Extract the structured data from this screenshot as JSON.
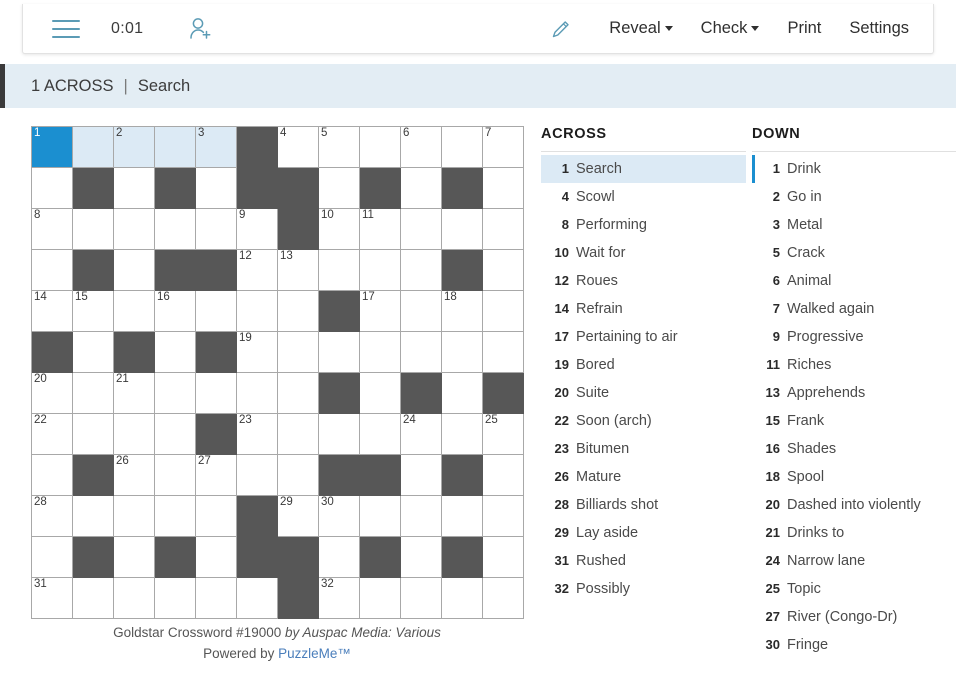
{
  "toolbar": {
    "menu_icon": "hamburger-icon",
    "timer": "0:01",
    "add_person_icon": "person-add-icon",
    "pencil_icon": "pencil-icon",
    "reveal_label": "Reveal",
    "check_label": "Check",
    "print_label": "Print",
    "settings_label": "Settings"
  },
  "clue_bar": {
    "number_direction": "1 ACROSS",
    "separator": "|",
    "clue": "Search"
  },
  "footer": {
    "title": "Goldstar Crossword #19000",
    "byline": "by Auspac Media: Various",
    "powered_prefix": "Powered by",
    "powered_brand": "PuzzleMe™"
  },
  "colors": {
    "selected_cell": "#1b8fd0",
    "highlight_cell": "#dceaf5",
    "block_cell": "#575757",
    "clue_bar_bg": "#e3edf4",
    "accent_link": "#4a7ebb",
    "icon_blue": "#5b9bb5"
  },
  "grid": {
    "rows": 12,
    "cols": 12,
    "cells": [
      [
        {
          "t": "sel",
          "n": "1"
        },
        {
          "t": "hl"
        },
        {
          "t": "hl",
          "n": "2"
        },
        {
          "t": "hl"
        },
        {
          "t": "hl",
          "n": "3"
        },
        {
          "t": "block"
        },
        {
          "t": "open",
          "n": "4"
        },
        {
          "t": "open",
          "n": "5"
        },
        {
          "t": "open"
        },
        {
          "t": "open",
          "n": "6"
        },
        {
          "t": "open"
        },
        {
          "t": "open",
          "n": "7"
        }
      ],
      [
        {
          "t": "open"
        },
        {
          "t": "block"
        },
        {
          "t": "open"
        },
        {
          "t": "block"
        },
        {
          "t": "open"
        },
        {
          "t": "block"
        },
        {
          "t": "block"
        },
        {
          "t": "open"
        },
        {
          "t": "block"
        },
        {
          "t": "open"
        },
        {
          "t": "block"
        },
        {
          "t": "open"
        }
      ],
      [
        {
          "t": "open",
          "n": "8"
        },
        {
          "t": "open"
        },
        {
          "t": "open"
        },
        {
          "t": "open"
        },
        {
          "t": "open"
        },
        {
          "t": "open",
          "n": "9"
        },
        {
          "t": "block"
        },
        {
          "t": "open",
          "n": "10"
        },
        {
          "t": "open",
          "n": "11"
        },
        {
          "t": "open"
        },
        {
          "t": "open"
        },
        {
          "t": "open"
        }
      ],
      [
        {
          "t": "open"
        },
        {
          "t": "block"
        },
        {
          "t": "open"
        },
        {
          "t": "block"
        },
        {
          "t": "block"
        },
        {
          "t": "open",
          "n": "12"
        },
        {
          "t": "open",
          "n": "13"
        },
        {
          "t": "open"
        },
        {
          "t": "open"
        },
        {
          "t": "open"
        },
        {
          "t": "block"
        },
        {
          "t": "open"
        }
      ],
      [
        {
          "t": "open",
          "n": "14"
        },
        {
          "t": "open",
          "n": "15"
        },
        {
          "t": "open"
        },
        {
          "t": "open",
          "n": "16"
        },
        {
          "t": "open"
        },
        {
          "t": "open"
        },
        {
          "t": "open"
        },
        {
          "t": "block"
        },
        {
          "t": "open",
          "n": "17"
        },
        {
          "t": "open"
        },
        {
          "t": "open",
          "n": "18"
        },
        {
          "t": "open"
        }
      ],
      [
        {
          "t": "block"
        },
        {
          "t": "open"
        },
        {
          "t": "block"
        },
        {
          "t": "open"
        },
        {
          "t": "block"
        },
        {
          "t": "open",
          "n": "19"
        },
        {
          "t": "open"
        },
        {
          "t": "open"
        },
        {
          "t": "open"
        },
        {
          "t": "open"
        },
        {
          "t": "open"
        },
        {
          "t": "open"
        }
      ],
      [
        {
          "t": "open",
          "n": "20"
        },
        {
          "t": "open"
        },
        {
          "t": "open",
          "n": "21"
        },
        {
          "t": "open"
        },
        {
          "t": "open"
        },
        {
          "t": "open"
        },
        {
          "t": "open"
        },
        {
          "t": "block"
        },
        {
          "t": "open"
        },
        {
          "t": "block"
        },
        {
          "t": "open"
        },
        {
          "t": "block"
        }
      ],
      [
        {
          "t": "open",
          "n": "22"
        },
        {
          "t": "open"
        },
        {
          "t": "open"
        },
        {
          "t": "open"
        },
        {
          "t": "block"
        },
        {
          "t": "open",
          "n": "23"
        },
        {
          "t": "open"
        },
        {
          "t": "open"
        },
        {
          "t": "open"
        },
        {
          "t": "open",
          "n": "24"
        },
        {
          "t": "open"
        },
        {
          "t": "open",
          "n": "25"
        }
      ],
      [
        {
          "t": "open"
        },
        {
          "t": "block"
        },
        {
          "t": "open",
          "n": "26"
        },
        {
          "t": "open"
        },
        {
          "t": "open",
          "n": "27"
        },
        {
          "t": "open"
        },
        {
          "t": "open"
        },
        {
          "t": "block"
        },
        {
          "t": "block"
        },
        {
          "t": "open"
        },
        {
          "t": "block"
        },
        {
          "t": "open"
        }
      ],
      [
        {
          "t": "open",
          "n": "28"
        },
        {
          "t": "open"
        },
        {
          "t": "open"
        },
        {
          "t": "open"
        },
        {
          "t": "open"
        },
        {
          "t": "block"
        },
        {
          "t": "open",
          "n": "29"
        },
        {
          "t": "open",
          "n": "30"
        },
        {
          "t": "open"
        },
        {
          "t": "open"
        },
        {
          "t": "open"
        },
        {
          "t": "open"
        }
      ],
      [
        {
          "t": "open"
        },
        {
          "t": "block"
        },
        {
          "t": "open"
        },
        {
          "t": "block"
        },
        {
          "t": "open"
        },
        {
          "t": "block"
        },
        {
          "t": "block"
        },
        {
          "t": "open"
        },
        {
          "t": "block"
        },
        {
          "t": "open"
        },
        {
          "t": "block"
        },
        {
          "t": "open"
        }
      ],
      [
        {
          "t": "open",
          "n": "31"
        },
        {
          "t": "open"
        },
        {
          "t": "open"
        },
        {
          "t": "open"
        },
        {
          "t": "open"
        },
        {
          "t": "open"
        },
        {
          "t": "block"
        },
        {
          "t": "open",
          "n": "32"
        },
        {
          "t": "open"
        },
        {
          "t": "open"
        },
        {
          "t": "open"
        },
        {
          "t": "open"
        }
      ]
    ]
  },
  "across": {
    "title": "ACROSS",
    "clues": [
      {
        "num": "1",
        "text": "Search",
        "state": "active"
      },
      {
        "num": "4",
        "text": "Scowl",
        "state": ""
      },
      {
        "num": "8",
        "text": "Performing",
        "state": ""
      },
      {
        "num": "10",
        "text": "Wait for",
        "state": ""
      },
      {
        "num": "12",
        "text": "Roues",
        "state": ""
      },
      {
        "num": "14",
        "text": "Refrain",
        "state": ""
      },
      {
        "num": "17",
        "text": "Pertaining to air",
        "state": ""
      },
      {
        "num": "19",
        "text": "Bored",
        "state": ""
      },
      {
        "num": "20",
        "text": "Suite",
        "state": ""
      },
      {
        "num": "22",
        "text": "Soon (arch)",
        "state": ""
      },
      {
        "num": "23",
        "text": "Bitumen",
        "state": ""
      },
      {
        "num": "26",
        "text": "Mature",
        "state": ""
      },
      {
        "num": "28",
        "text": "Billiards shot",
        "state": ""
      },
      {
        "num": "29",
        "text": "Lay aside",
        "state": ""
      },
      {
        "num": "31",
        "text": "Rushed",
        "state": ""
      },
      {
        "num": "32",
        "text": "Possibly",
        "state": ""
      }
    ]
  },
  "down": {
    "title": "DOWN",
    "clues": [
      {
        "num": "1",
        "text": "Drink",
        "state": "marked"
      },
      {
        "num": "2",
        "text": "Go in",
        "state": ""
      },
      {
        "num": "3",
        "text": "Metal",
        "state": ""
      },
      {
        "num": "5",
        "text": "Crack",
        "state": ""
      },
      {
        "num": "6",
        "text": "Animal",
        "state": ""
      },
      {
        "num": "7",
        "text": "Walked again",
        "state": ""
      },
      {
        "num": "9",
        "text": "Progressive",
        "state": ""
      },
      {
        "num": "11",
        "text": "Riches",
        "state": ""
      },
      {
        "num": "13",
        "text": "Apprehends",
        "state": ""
      },
      {
        "num": "15",
        "text": "Frank",
        "state": ""
      },
      {
        "num": "16",
        "text": "Shades",
        "state": ""
      },
      {
        "num": "18",
        "text": "Spool",
        "state": ""
      },
      {
        "num": "20",
        "text": "Dashed into violently",
        "state": ""
      },
      {
        "num": "21",
        "text": "Drinks to",
        "state": ""
      },
      {
        "num": "24",
        "text": "Narrow lane",
        "state": ""
      },
      {
        "num": "25",
        "text": "Topic",
        "state": ""
      },
      {
        "num": "27",
        "text": "River (Congo-Dr)",
        "state": ""
      },
      {
        "num": "30",
        "text": "Fringe",
        "state": ""
      }
    ]
  }
}
